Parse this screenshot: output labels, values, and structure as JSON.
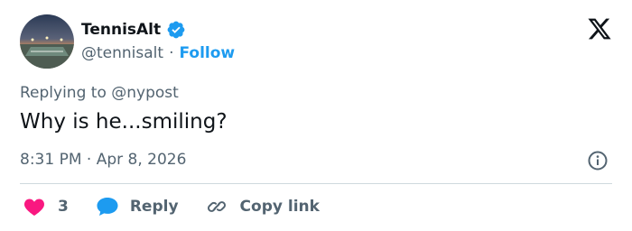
{
  "author": {
    "display_name": "TennisAlt",
    "handle": "@tennisalt",
    "separator": "·",
    "follow_label": "Follow"
  },
  "tweet": {
    "replying_to": "Replying to @nypost",
    "text": "Why is he...smiling?",
    "timestamp": "8:31 PM · Apr 8, 2026"
  },
  "actions": {
    "like_count": "3",
    "reply_label": "Reply",
    "copy_link_label": "Copy link"
  },
  "icons": {
    "brand": "x-logo-icon",
    "verified": "verified-badge-icon",
    "info": "info-icon",
    "like": "heart-icon",
    "reply": "speech-bubble-icon",
    "copy": "link-icon"
  },
  "colors": {
    "accent": "#1d9bf0",
    "like": "#f91880",
    "text": "#0f1419",
    "secondary": "#536471",
    "divider": "#cfd9de"
  }
}
